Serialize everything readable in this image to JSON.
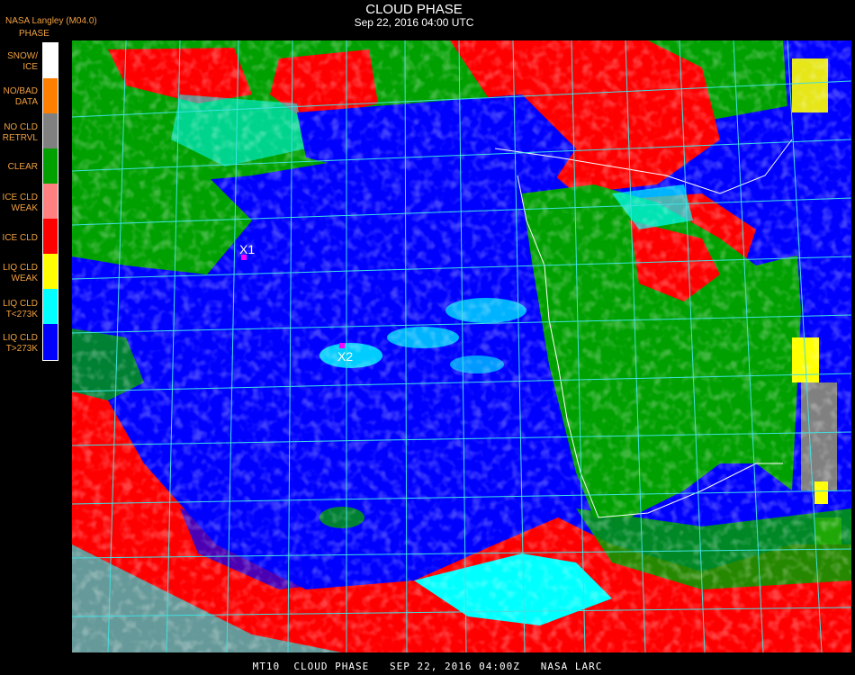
{
  "header": {
    "source": "NASA Langley (M04.0)",
    "product_short": "PHASE",
    "title": "CLOUD PHASE",
    "datetime": "Sep 22, 2016 04:00 UTC"
  },
  "legend": {
    "items": [
      {
        "label": "SNOW/\nICE",
        "color": "#ffffff"
      },
      {
        "label": "NO/BAD\nDATA",
        "color": "#ff8000"
      },
      {
        "label": "NO CLD\nRETRVL",
        "color": "#808080"
      },
      {
        "label": "CLEAR",
        "color": "#00a000"
      },
      {
        "label": "ICE CLD\nWEAK",
        "color": "#ff8080"
      },
      {
        "label": "ICE CLD",
        "color": "#ff0000"
      },
      {
        "label": "LIQ CLD\nWEAK",
        "color": "#ffff00"
      },
      {
        "label": "LIQ CLD\nT<273K",
        "color": "#00ffff"
      },
      {
        "label": "LIQ CLD\nT>273K",
        "color": "#0000ff"
      }
    ]
  },
  "markers": [
    {
      "label": "X1",
      "color": "#ff00ff"
    },
    {
      "label": "X2",
      "color": "#ff00ff"
    }
  ],
  "map": {
    "grid_color": "#40e0e0",
    "coastline_color": "#ffffff",
    "background_color": "#000000"
  },
  "footer": {
    "text": "MT10  CLOUD PHASE   SEP 22, 2016 04:00Z   NASA LARC"
  }
}
